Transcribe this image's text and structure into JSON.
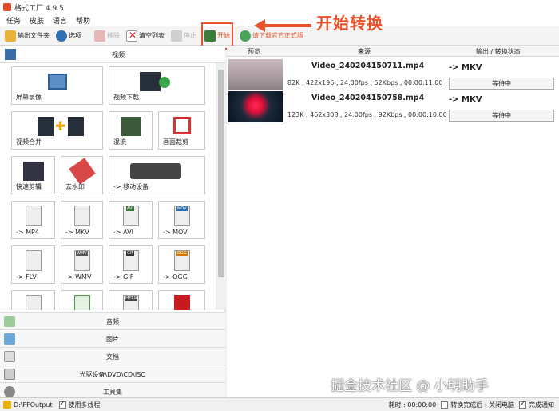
{
  "window": {
    "title": "格式工厂 4.9.5"
  },
  "menu": [
    "任务",
    "皮肤",
    "语言",
    "帮助"
  ],
  "toolbar": {
    "output_folder": "输出文件夹",
    "options": "选项",
    "remove": "移除",
    "clear_list": "清空列表",
    "stop": "停止",
    "start": "开始",
    "download": "请下载官方正式版"
  },
  "annotation": {
    "callout": "开始转换"
  },
  "left": {
    "video_category": "视频",
    "tiles": [
      "屏幕录像",
      "视频下载",
      "视频合并",
      "混流",
      "画面裁剪",
      "快速剪辑",
      "去水印",
      "-> 移动设备",
      "-> MP4",
      "-> MKV",
      "-> AVI",
      "-> MOV",
      "-> FLV",
      "-> WMV",
      "-> GIF",
      "-> OGG"
    ],
    "icon_badges": {
      "avi": "AVI",
      "mov": "MOV",
      "wmv": "WMV",
      "gif": "GIF",
      "ogg": "OGG",
      "mpeg": "MPEG"
    },
    "categories": [
      "音频",
      "图片",
      "文档",
      "光驱设备\\DVD\\CD\\ISO",
      "工具集"
    ]
  },
  "right": {
    "headers": {
      "preview": "预览",
      "source": "来源",
      "output": "输出 / 转换状态"
    },
    "rows": [
      {
        "name": "Video_240204150711.mp4",
        "meta": "82K , 422x196 , 24.00fps , 52Kbps , 00:00:11.00",
        "format": "-> MKV",
        "status": "等待中"
      },
      {
        "name": "Video_240204150758.mp4",
        "meta": "123K , 462x308 , 24.00fps , 92Kbps , 00:00:10.00",
        "format": "-> MKV",
        "status": "等待中"
      }
    ]
  },
  "watermark": "掘金技术社区 @ 小明助手",
  "status": {
    "path": "D:\\FFOutput",
    "multithread": "使用多线程",
    "elapsed": "耗时 : 00:00:00",
    "after": "转换完成后 : 关闭电脑",
    "notify": "完成通知"
  }
}
